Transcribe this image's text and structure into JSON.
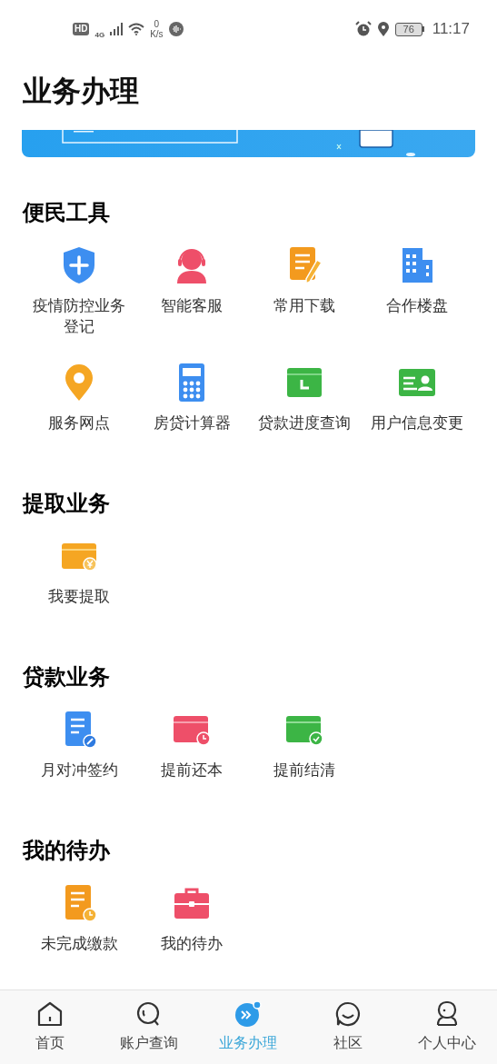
{
  "status_bar": {
    "hd": "HD",
    "network": "4G",
    "speed_value": "0",
    "speed_unit": "K/s",
    "battery": "76",
    "time": "11:17"
  },
  "title": "业务办理",
  "sections": [
    {
      "title": "便民工具",
      "items": [
        {
          "label": "疫情防控业务登记",
          "kind": "shield"
        },
        {
          "label": "智能客服",
          "kind": "headset"
        },
        {
          "label": "常用下载",
          "kind": "doc-pen"
        },
        {
          "label": "合作楼盘",
          "kind": "building"
        },
        {
          "label": "服务网点",
          "kind": "pin"
        },
        {
          "label": "房贷计算器",
          "kind": "calculator"
        },
        {
          "label": "贷款进度查询",
          "kind": "folder-clock"
        },
        {
          "label": "用户信息变更",
          "kind": "id-card"
        }
      ]
    },
    {
      "title": "提取业务",
      "items": [
        {
          "label": "我要提取",
          "kind": "wallet-yen"
        }
      ]
    },
    {
      "title": "贷款业务",
      "items": [
        {
          "label": "月对冲签约",
          "kind": "doc-pen-blue"
        },
        {
          "label": "提前还本",
          "kind": "card-clock"
        },
        {
          "label": "提前结清",
          "kind": "card-check"
        }
      ]
    },
    {
      "title": "我的待办",
      "items": [
        {
          "label": "未完成缴款",
          "kind": "doc-clock"
        },
        {
          "label": "我的待办",
          "kind": "briefcase"
        }
      ]
    }
  ],
  "nav": [
    {
      "label": "首页",
      "kind": "home",
      "selected": false
    },
    {
      "label": "账户查询",
      "kind": "search",
      "selected": false
    },
    {
      "label": "业务办理",
      "kind": "business",
      "selected": true
    },
    {
      "label": "社区",
      "kind": "chat",
      "selected": false
    },
    {
      "label": "个人中心",
      "kind": "person",
      "selected": false
    }
  ]
}
